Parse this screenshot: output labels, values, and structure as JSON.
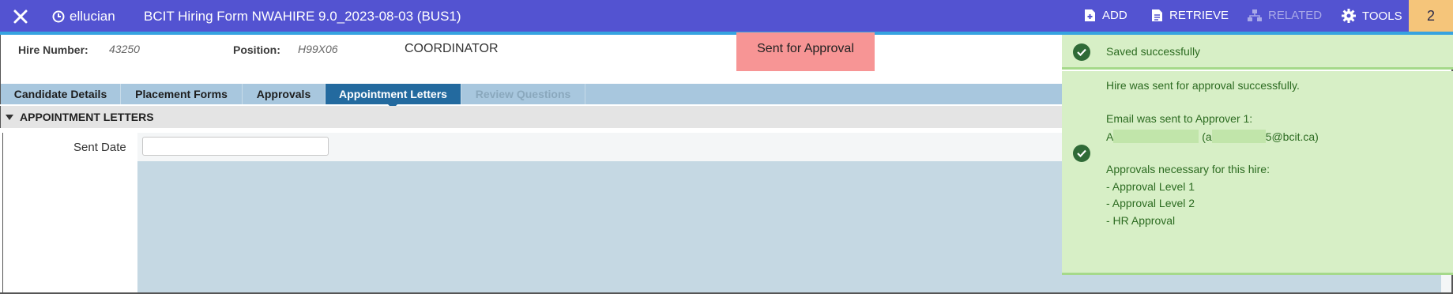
{
  "header": {
    "brand": "ellucian",
    "title": "BCIT Hiring Form NWAHIRE 9.0_2023-08-03 (BUS1)",
    "actions": [
      {
        "label": "ADD",
        "icon": "add-document-icon",
        "enabled": true
      },
      {
        "label": "RETRIEVE",
        "icon": "retrieve-document-icon",
        "enabled": true
      },
      {
        "label": "RELATED",
        "icon": "sitemap-icon",
        "enabled": false
      },
      {
        "label": "TOOLS",
        "icon": "gear-icon",
        "enabled": true
      }
    ],
    "notification_count": "2",
    "accent": "#5353d1"
  },
  "key_block": {
    "hire_number_label": "Hire Number:",
    "hire_number_value": "43250",
    "position_label": "Position:",
    "position_value": "H99X06",
    "position_desc": "COORDINATOR",
    "status": "Sent for Approval",
    "status_color": "#f79595"
  },
  "tabs": [
    {
      "label": "Candidate Details",
      "state": "normal"
    },
    {
      "label": "Placement Forms",
      "state": "normal"
    },
    {
      "label": "Approvals",
      "state": "normal"
    },
    {
      "label": "Appointment Letters",
      "state": "active"
    },
    {
      "label": "Review Questions",
      "state": "disabled"
    }
  ],
  "section": {
    "title": "APPOINTMENT LETTERS",
    "sent_date_label": "Sent Date",
    "sent_date_value": ""
  },
  "notifications": {
    "saved": "Saved successfully",
    "sent_line": "Hire was sent for approval successfully.",
    "email_line": "Email was sent to Approver 1:",
    "approver_prefix": "A",
    "approver_email_open": "(a",
    "approver_email_suffix": "5@bcit.ca)",
    "approvals_heading": "Approvals necessary for this hire:",
    "approval_levels": [
      "- Approval Level 1",
      "- Approval Level 2",
      "- HR Approval"
    ],
    "success_color": "#d7efc6"
  }
}
